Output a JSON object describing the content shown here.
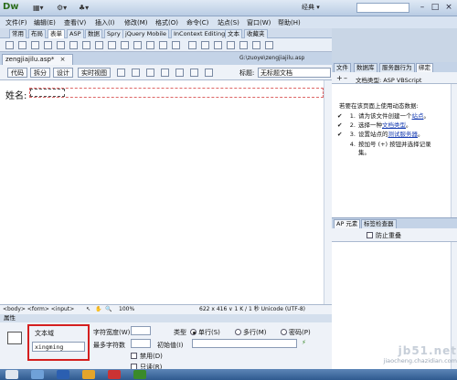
{
  "app": {
    "logo_text": "Dw",
    "workspace": "经典 ▾",
    "window_buttons": [
      "–",
      "□",
      "×"
    ]
  },
  "menu": [
    "文件(F)",
    "编辑(E)",
    "查看(V)",
    "插入(I)",
    "修改(M)",
    "格式(O)",
    "命令(C)",
    "站点(S)",
    "窗口(W)",
    "帮助(H)"
  ],
  "insert_tabs": [
    "常用",
    "布局",
    "表单",
    "ASP",
    "数据",
    "Spry",
    "jQuery Mobile",
    "InContext Editing",
    "文本",
    "收藏夹"
  ],
  "insert_active_tab": "表单",
  "document": {
    "tab_name": "zengjiajilu.asp*",
    "path": "G:\\zuoye\\zengjiajilu.asp",
    "view_buttons": [
      "代码",
      "拆分",
      "设计",
      "实时视图"
    ],
    "title_label": "标题:",
    "title_value": "无标题文档",
    "canvas_label": "姓名:"
  },
  "status": {
    "tag_path": "<body> <form> <input>",
    "zoom": "100%",
    "size_info": "622 x 416 ∨ 1 K / 1 秒 Unicode (UTF-8)"
  },
  "properties": {
    "header": "属性",
    "textfield_label": "文本域",
    "textfield_name": "xingming",
    "char_width_label": "字符宽度(W)",
    "max_chars_label": "最多字符数",
    "type_label": "类型",
    "type_options": [
      "单行(S)",
      "多行(M)",
      "密码(P)"
    ],
    "type_selected": "单行(S)",
    "init_value_label": "初始值(I)",
    "disabled_label": "禁用(D)",
    "readonly_label": "只读(R)"
  },
  "right_panel": {
    "tabs": [
      "文件",
      "数据库",
      "服务器行为",
      "绑定"
    ],
    "active_tab": "绑定",
    "doc_type": "文档类型: ASP VBScript",
    "intro": "若要在该页面上使用动态数据:",
    "steps": [
      {
        "num": "1.",
        "text": "请为该文件创建一个",
        "link": "站点",
        "end": "。"
      },
      {
        "num": "2.",
        "text": "选择一种",
        "link": "文档类型",
        "end": "。"
      },
      {
        "num": "3.",
        "text": "设置站点的",
        "link": "测试服务器",
        "end": "。"
      },
      {
        "num": "4.",
        "text": "按加号 (+) 按钮并选择记录",
        "link": "",
        "end": "",
        "cont": "集。"
      }
    ]
  },
  "ap_panel": {
    "tabs": [
      "AP 元素",
      "标签检查器"
    ],
    "prevent_overlap": "防止重叠"
  },
  "watermark": {
    "main": "jb51.net",
    "url": "jiaocheng.chazidian.com"
  },
  "colors": {
    "accent": "#1a3fb3",
    "highlight": "#d41f1f"
  }
}
